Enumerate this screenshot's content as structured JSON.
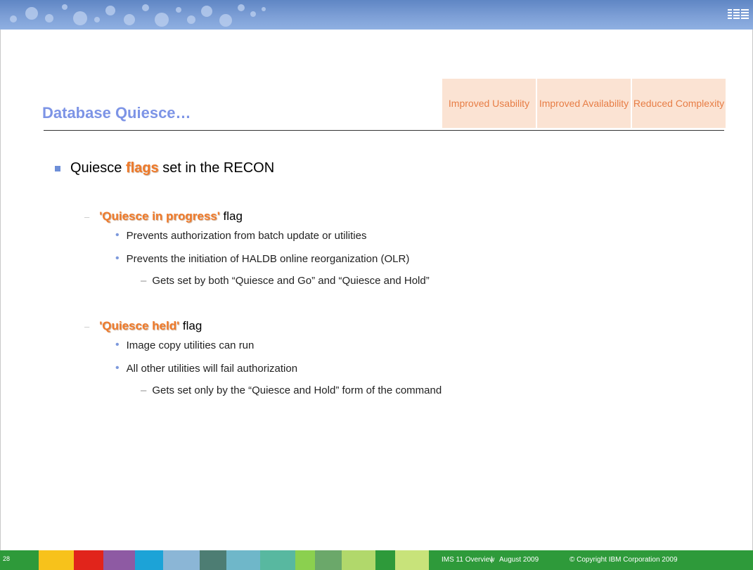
{
  "header": {
    "logo_text": "IBM"
  },
  "slide": {
    "title": "Database Quiesce…",
    "tags": [
      "Improved Usability",
      "Improved Availability",
      "Reduced Complexity"
    ],
    "bullet1": {
      "pre": "Quiesce ",
      "highlight": "flags",
      "post": " set in the RECON"
    },
    "flag1": {
      "name": "'Quiesce in progress'",
      "suffix": " flag",
      "items": [
        "Prevents authorization from batch update or utilities",
        "Prevents the initiation of HALDB online reorganization (OLR)"
      ],
      "sub": "Gets set by both “Quiesce and Go” and “Quiesce and Hold”"
    },
    "flag2": {
      "name": "'Quiesce held'",
      "suffix": " flag",
      "items": [
        "Image copy utilities can run",
        "All other utilities will fail authorization"
      ],
      "sub": "Gets set only by the “Quiesce and Hold” form of the command"
    }
  },
  "footer": {
    "page_number": "28",
    "course": "IMS 11 Overview",
    "separator": "|",
    "date": "August 2009",
    "copyright": "© Copyright IBM Corporation 2009"
  },
  "colors": {
    "title": "#7d94e6",
    "highlight": "#ef7a2a",
    "tag_bg": "#fbe3d3",
    "footer_green": "#2e9a3a"
  }
}
